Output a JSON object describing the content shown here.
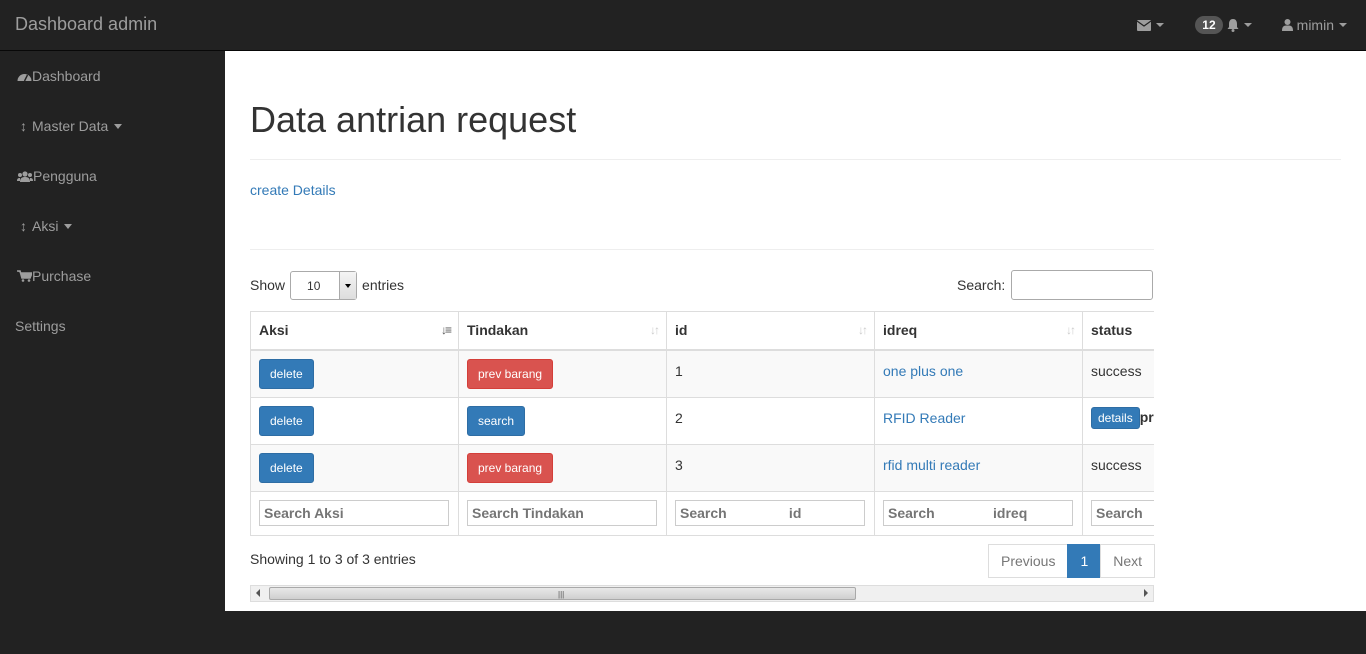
{
  "navbar": {
    "brand": "Dashboard admin",
    "notification_count": "12",
    "user": "mimin",
    "icons": [
      "envelope-icon",
      "bell-icon",
      "user-icon"
    ]
  },
  "sidebar": {
    "items": [
      {
        "label": "Dashboard",
        "icon": "dashboard-icon"
      },
      {
        "label": "Master Data",
        "icon": "arrows-v-icon"
      },
      {
        "label": "Pengguna",
        "icon": "users-icon"
      },
      {
        "label": "Aksi",
        "icon": "arrows-v-icon"
      },
      {
        "label": "Purchase",
        "icon": "cart-icon"
      },
      {
        "label": "Settings",
        "icon": ""
      }
    ]
  },
  "main": {
    "title": "Data antrian request",
    "create_link": "create Details",
    "length": {
      "label_before": "Show",
      "value": "10",
      "label_after": "entries"
    },
    "search_label": "Search:",
    "columns": [
      "Aksi",
      "Tindakan",
      "id",
      "idreq",
      "status"
    ],
    "rows": [
      {
        "aksi": "delete",
        "tindakan": "prev barang",
        "tindakan_style": "danger",
        "id": "1",
        "idreq": "one plus one",
        "status": "success"
      },
      {
        "aksi": "delete",
        "tindakan": "search",
        "tindakan_style": "primary",
        "id": "2",
        "idreq": "RFID Reader",
        "status_button": "details",
        "status": "pr"
      },
      {
        "aksi": "delete",
        "tindakan": "prev barang",
        "tindakan_style": "danger",
        "id": "3",
        "idreq": "rfid multi reader",
        "status": "success"
      }
    ],
    "footer_search": [
      "Search Aksi",
      "Search Tindakan",
      "Search                id",
      "Search               idreq",
      "Search"
    ],
    "info": "Showing 1 to 3 of 3 entries",
    "pagination": {
      "previous": "Previous",
      "current": "1",
      "next": "Next"
    }
  },
  "colors": {
    "primary": "#337ab7",
    "danger": "#d9534f",
    "navbar": "#222222"
  }
}
